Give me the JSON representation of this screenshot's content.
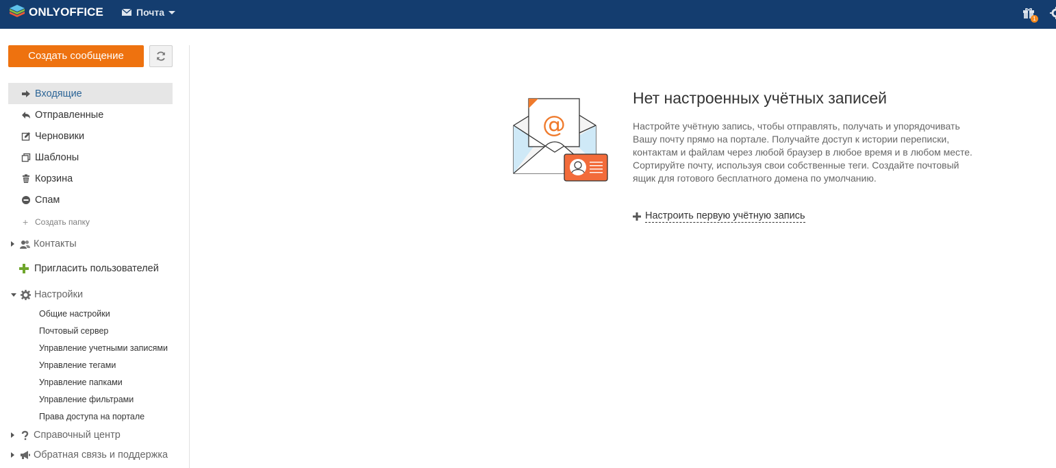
{
  "topbar": {
    "logo_text": "ONLYOFFICE",
    "module_label": "Почта",
    "notification_count": "1",
    "bg_color": "#143d6f"
  },
  "sidebar": {
    "create_button": "Создать сообщение",
    "accent_color": "#ee720f",
    "folders": [
      {
        "label": "Входящие",
        "icon": "inbox-arrow-icon",
        "active": true
      },
      {
        "label": "Отправленные",
        "icon": "sent-icon"
      },
      {
        "label": "Черновики",
        "icon": "draft-icon"
      },
      {
        "label": "Шаблоны",
        "icon": "templates-icon"
      },
      {
        "label": "Корзина",
        "icon": "trash-icon"
      },
      {
        "label": "Спам",
        "icon": "spam-icon"
      }
    ],
    "create_folder": "Создать папку",
    "contacts": "Контакты",
    "invite": "Пригласить пользователей",
    "settings": "Настройки",
    "settings_items": [
      "Общие настройки",
      "Почтовый сервер",
      "Управление учетными записями",
      "Управление тегами",
      "Управление папками",
      "Управление фильтрами",
      "Права доступа на портале"
    ],
    "help_center": "Справочный центр",
    "feedback": "Обратная связь и поддержка"
  },
  "main": {
    "empty_title": "Нет настроенных учётных записей",
    "empty_description": "Настройте учётную запись, чтобы отправлять, получать и упорядочивать Вашу почту прямо на портале. Получайте доступ к истории переписки, контактам и файлам через любой браузер в любое время и в любом месте. Сортируйте почту, используя свои собственные теги. Создайте почтовый ящик для готового бесплатного домена по умолчанию.",
    "setup_link": "Настроить первую учётную запись"
  }
}
